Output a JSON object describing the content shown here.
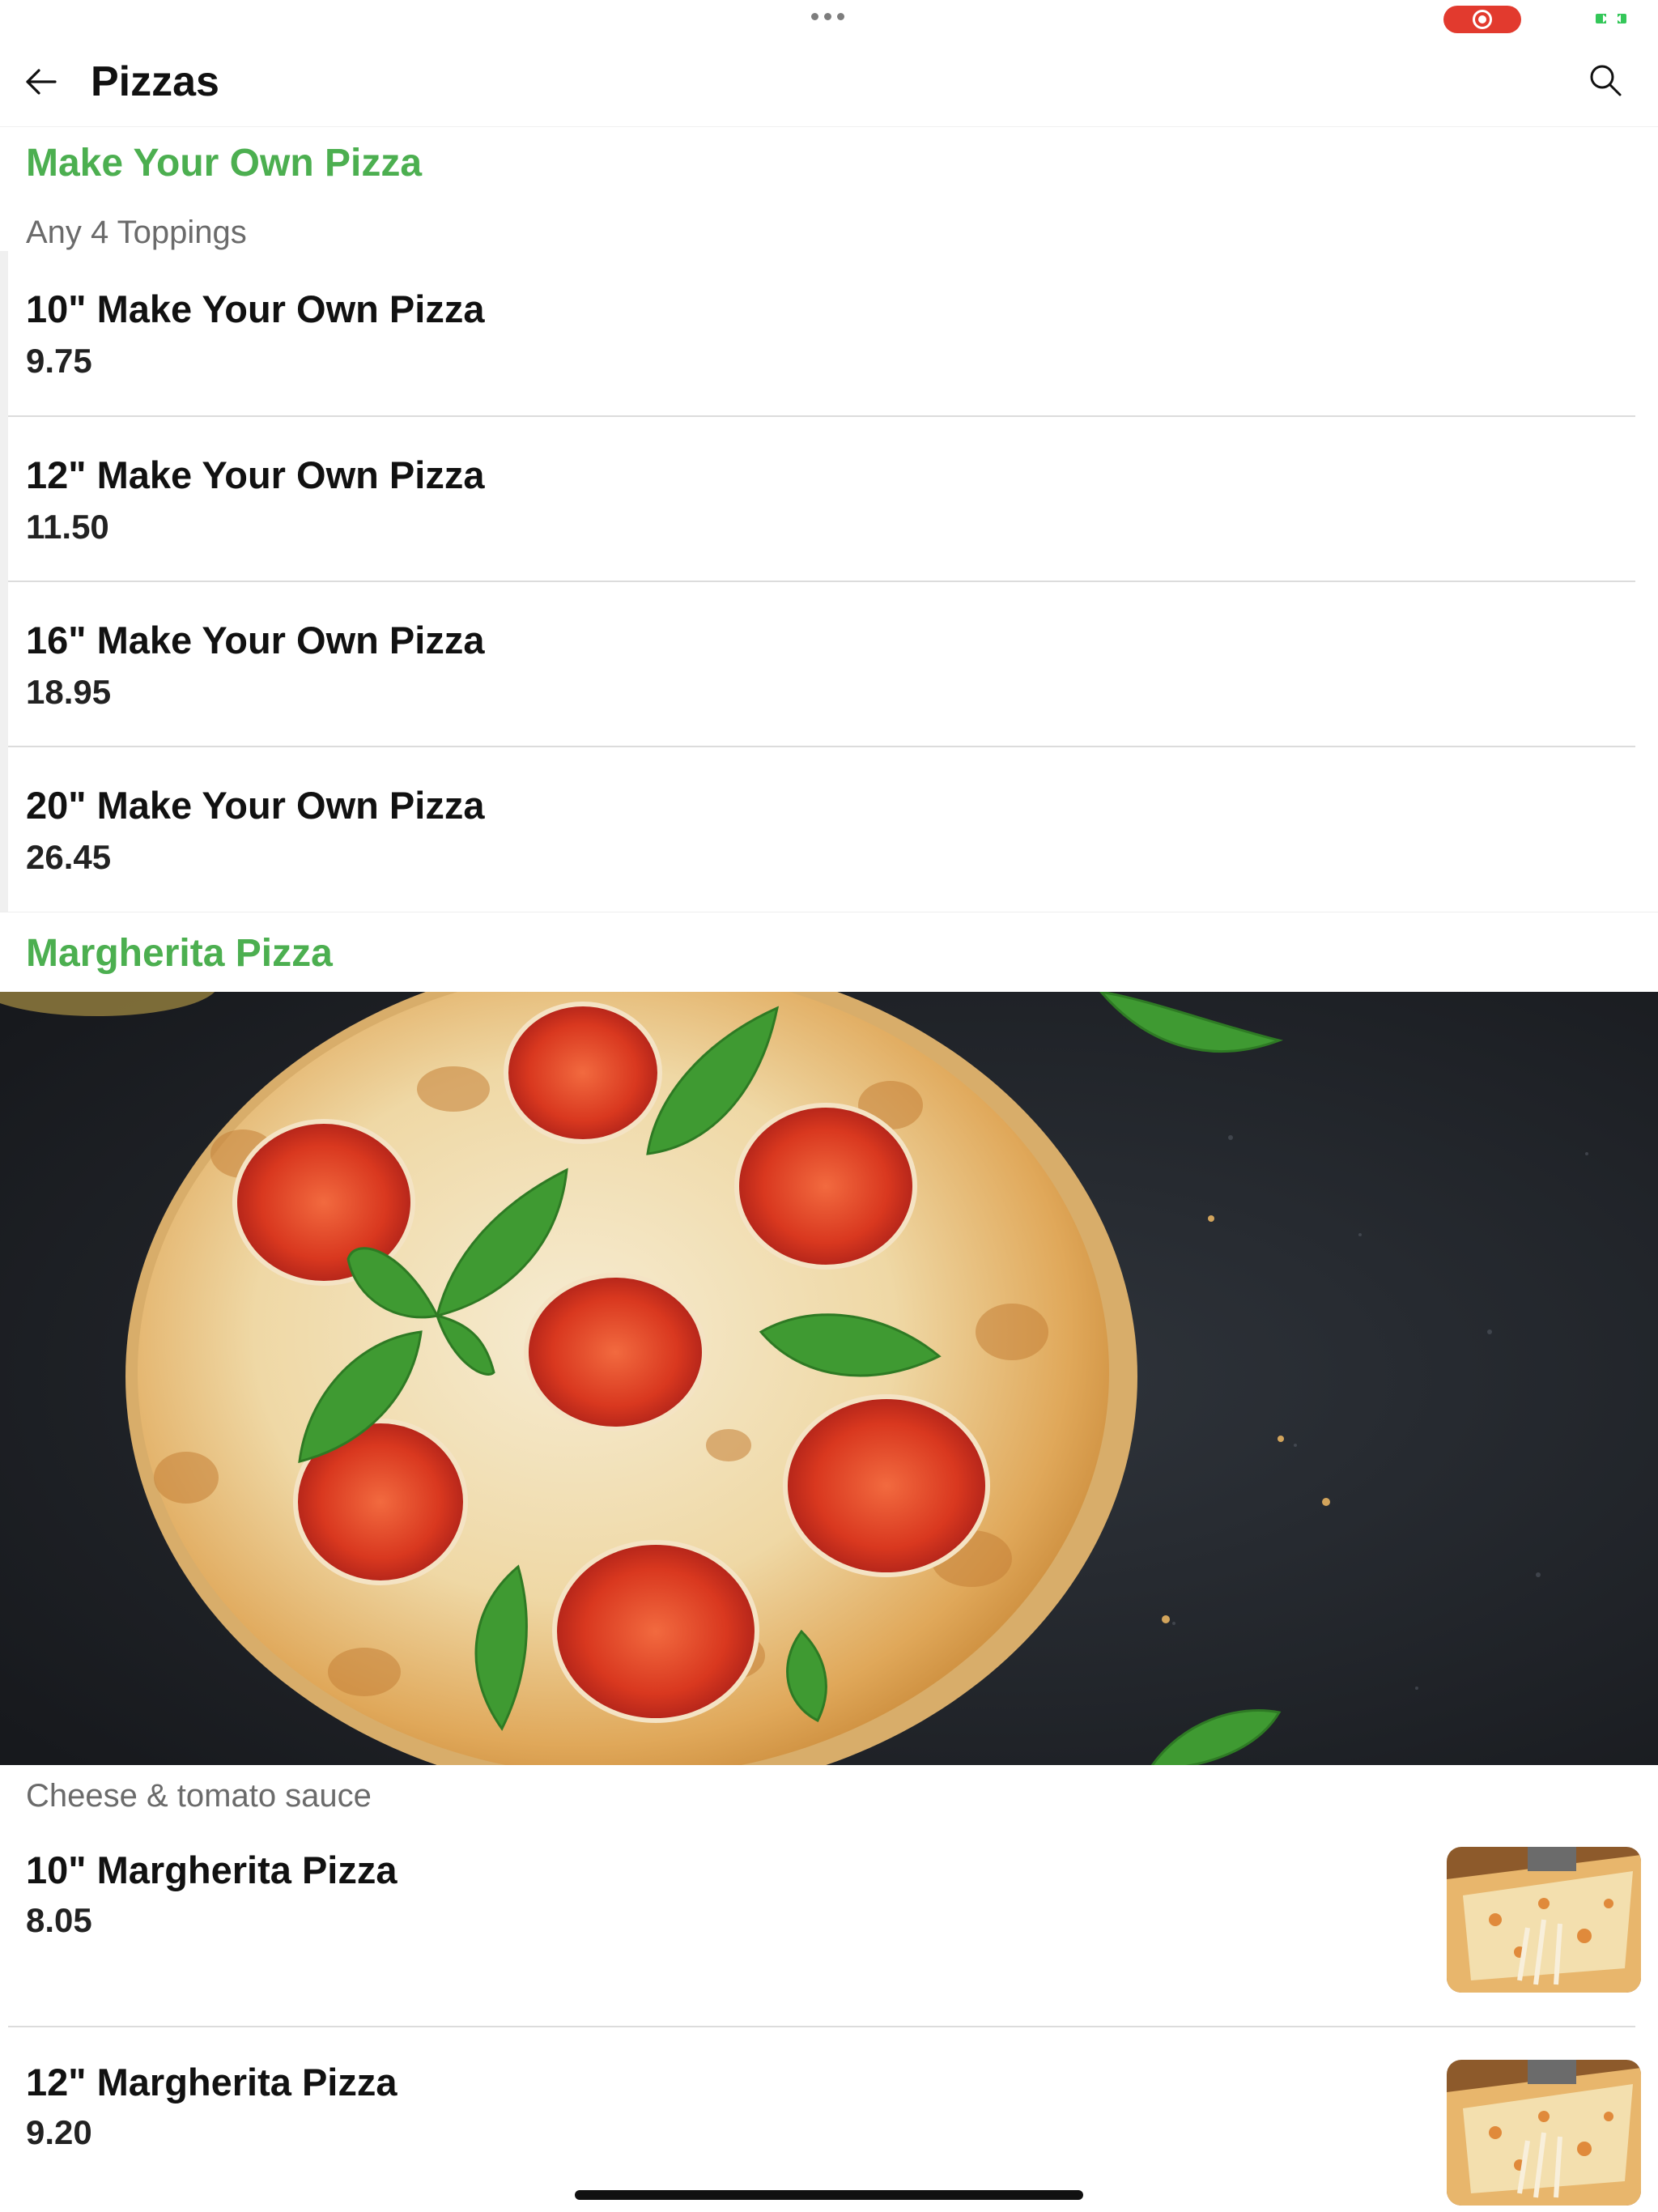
{
  "nav": {
    "title": "Pizzas"
  },
  "sections": [
    {
      "title": "Make Your Own Pizza",
      "description": "Any 4 Toppings",
      "items": [
        {
          "name": "10\" Make Your Own Pizza",
          "price": "9.75"
        },
        {
          "name": "12\" Make Your Own Pizza",
          "price": "11.50"
        },
        {
          "name": "16\" Make Your Own Pizza",
          "price": "18.95"
        },
        {
          "name": "20\" Make Your Own Pizza",
          "price": "26.45"
        }
      ]
    },
    {
      "title": "Margherita Pizza",
      "description": "Cheese & tomato sauce",
      "items": [
        {
          "name": "10\" Margherita Pizza",
          "price": "8.05"
        },
        {
          "name": "12\" Margherita Pizza",
          "price": "9.20"
        }
      ]
    }
  ],
  "colors": {
    "accent": "#4caf50",
    "record": "#e23a2e",
    "battery": "#34c759"
  }
}
